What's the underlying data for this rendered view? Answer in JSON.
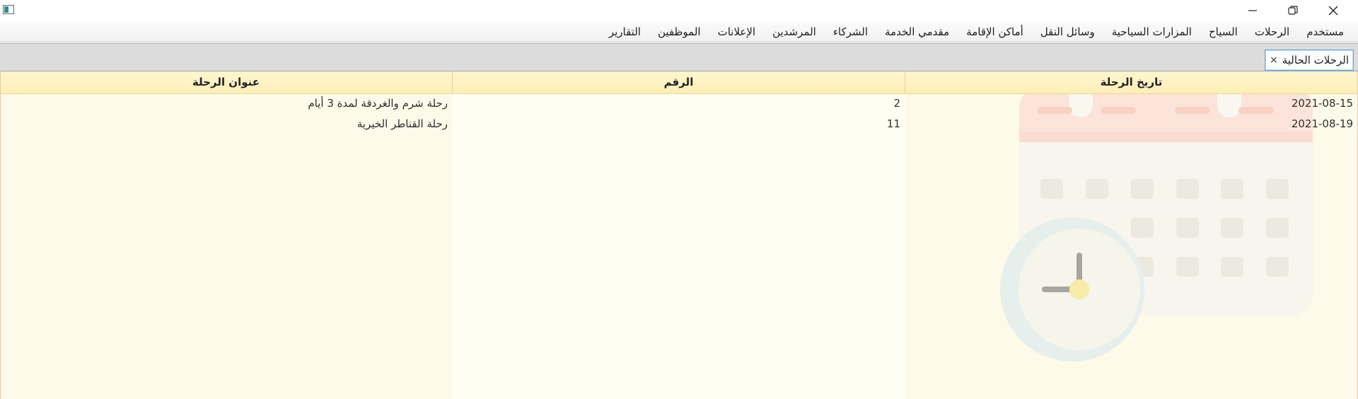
{
  "menu": {
    "items": [
      "مستخدم",
      "الرحلات",
      "السياح",
      "المزارات السياحية",
      "وسائل النقل",
      "أماكن الإقامة",
      "مقدمي الخدمة",
      "الشركاء",
      "المرشدين",
      "الإعلانات",
      "الموظفين",
      "التقارير"
    ]
  },
  "tab": {
    "label": "الرحلات الحالية",
    "close": "×"
  },
  "table": {
    "columns": [
      "تاريخ الرحلة",
      "الرقم",
      "عنوان الرحلة"
    ],
    "rows": [
      {
        "date": "2021-08-15",
        "number": "2",
        "title": "رحلة شرم والغردقة لمدة 3 أيام"
      },
      {
        "date": "2021-08-19",
        "number": "11",
        "title": "رحلة القناطر الخيرية"
      }
    ]
  },
  "icons": {
    "app": "app-window-icon",
    "minimize": "minimize-icon",
    "maximize": "restore-icon",
    "close": "close-icon",
    "watermark": "calendar-clock-icon"
  },
  "colors": {
    "header_bg": "#fff3c4",
    "table_bg": "#fffef2",
    "tab_border": "#6fa8dc"
  }
}
